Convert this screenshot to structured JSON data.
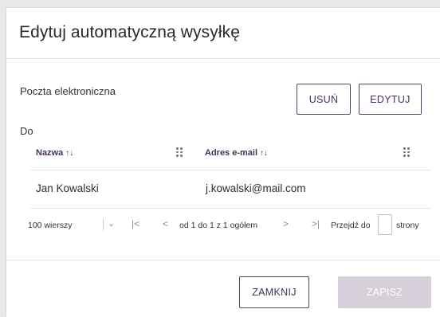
{
  "dialog": {
    "title": "Edytuj automatyczną wysyłkę"
  },
  "channel": {
    "label": "Poczta elektroniczna",
    "delete_label": "USUŃ",
    "edit_label": "EDYTUJ"
  },
  "recipients": {
    "label": "Do",
    "columns": [
      {
        "label": "Nazwa",
        "sort_icon": "sort-icon"
      },
      {
        "label": "Adres e-mail",
        "sort_icon": "sort-icon"
      }
    ],
    "rows": [
      {
        "name": "Jan Kowalski",
        "email": "j.kowalski@mail.com"
      }
    ]
  },
  "pagination": {
    "rows_per_page": "100 wierszy",
    "range": "od 1 do 1 z 1 ogółem",
    "goto_label": "Przejdź do",
    "goto_value": "",
    "goto_suffix": "strony",
    "icons": [
      "chevron-down-icon",
      "first-page-icon",
      "previous-page-icon",
      "next-page-icon",
      "last-page-icon"
    ]
  },
  "footer": {
    "close_label": "ZAMKNIJ",
    "save_label": "ZAPISZ"
  },
  "colors": {
    "accent": "#5c3c6b",
    "disabled_button": "#d6cfda"
  }
}
